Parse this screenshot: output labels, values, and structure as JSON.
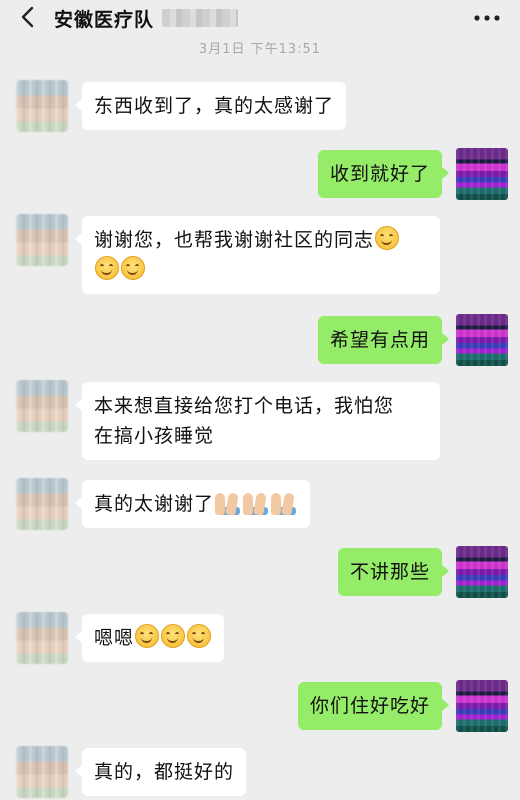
{
  "header": {
    "back_icon": "chevron-left-icon",
    "title": "安徽医疗队",
    "more_icon": "more-dots-icon"
  },
  "timestamp": "3月1日 下午13:51",
  "messages": [
    {
      "side": "left",
      "text": "东西收到了，真的太感谢了"
    },
    {
      "side": "right",
      "text": "收到就好了"
    },
    {
      "side": "left",
      "text": "谢谢您，也帮我谢谢社区的同志",
      "emojis": "smile x3"
    },
    {
      "side": "right",
      "text": "希望有点用"
    },
    {
      "side": "left",
      "line1": "本来想直接给您打个电话，我怕您",
      "line2": "在搞小孩睡觉"
    },
    {
      "side": "left",
      "text": "真的太谢谢了",
      "emojis": "pray x3"
    },
    {
      "side": "right",
      "text": "不讲那些"
    },
    {
      "side": "left",
      "text": "嗯嗯",
      "emojis": "smile x3"
    },
    {
      "side": "right",
      "text": "你们住好吃好"
    },
    {
      "side": "left",
      "text": "真的，都挺好的"
    }
  ],
  "colors": {
    "background": "#ededed",
    "bubble_left": "#ffffff",
    "bubble_right": "#95ec69"
  }
}
